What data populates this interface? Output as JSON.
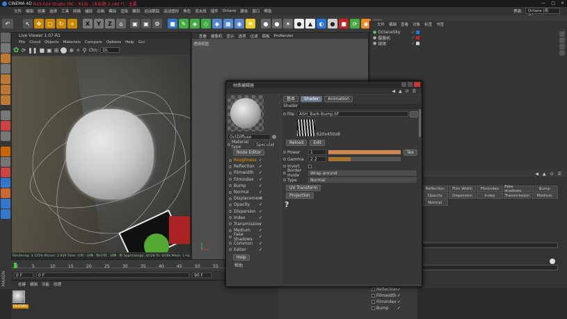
{
  "title_bar": {
    "app_name": "CINEMA 4D",
    "version": "R19.024 Studio (RC - R19) - [未标题 2.c4d *] - 主要",
    "window_controls": [
      "—",
      "□",
      "×"
    ]
  },
  "menu": {
    "items": [
      "文件",
      "编辑",
      "创建",
      "选择",
      "工具",
      "网格",
      "捕捉",
      "动画",
      "模拟",
      "渲染",
      "雕刻",
      "运动跟踪",
      "运动图形",
      "角色",
      "流水线",
      "插件",
      "Octane",
      "脚本",
      "窗口",
      "帮助"
    ],
    "layout_label": "界面:",
    "layout_value": "Octane (用户)"
  },
  "toolbar": {
    "axis_x": "X",
    "axis_y": "Y",
    "axis_z": "Z"
  },
  "live_viewer": {
    "title": "Live Viewer 1.07-R1",
    "menu": [
      "File",
      "Cloud",
      "Objects",
      "Materials",
      "Compare",
      "Options",
      "Help",
      "Gui"
    ],
    "chan_label": "Chn:",
    "chan_value": "DL",
    "status": "Rendering: 3.125% Ms/sec: 2.939  Time: 小时 : 分钟 : 秒/小时 : 分钟 : 秒  Spp/maxspp: 4/128  Tri: 0/16k  Mesh: 1  Hair: 0"
  },
  "viewport": {
    "menu": [
      "查看",
      "摄像机",
      "显示",
      "选项",
      "过滤",
      "面板",
      "ProRender"
    ],
    "label": "透视视图"
  },
  "object_manager": {
    "menu": [
      "文件",
      "编辑",
      "查看",
      "对象",
      "标签",
      "书签"
    ],
    "objects": [
      {
        "name": "OctaneSky"
      },
      {
        "name": "摄像机"
      },
      {
        "name": "球体"
      }
    ]
  },
  "material_editor": {
    "title": "材质编辑器",
    "tabs": {
      "basic": "基本",
      "shader": "Shader",
      "animation": "Animation"
    },
    "material_name": "OctDiffuse",
    "material_type_label": "Material type",
    "material_type_value": "Specular",
    "node_editor": "Node Editor",
    "help_button": "Help",
    "channels": [
      {
        "name": "Roughness",
        "active": true
      },
      {
        "name": "Reflection"
      },
      {
        "name": "Filmwidth"
      },
      {
        "name": "Filmindex"
      },
      {
        "name": "Bump"
      },
      {
        "name": "Normal"
      },
      {
        "name": "Displacement"
      },
      {
        "name": "Opacity"
      },
      {
        "name": "Dispersion"
      },
      {
        "name": "Index"
      },
      {
        "name": "Transmission"
      },
      {
        "name": "Medium"
      },
      {
        "name": "Fake Shadows"
      },
      {
        "name": "Common"
      },
      {
        "name": "Editor"
      }
    ],
    "bottom_label": "帮助",
    "shader": {
      "section": "Shader",
      "file_label": "File",
      "file_value": "ASH_Bark-Bump.tif",
      "resolution": "620x450x8",
      "reload": "Reload",
      "edit": "Edit",
      "power_label": "Power",
      "power_value": "1",
      "power_fill_percent": 100,
      "tex_button": "Tex",
      "gamma_label": "Gamma",
      "gamma_value": "2.2",
      "invert_label": "Invert",
      "border_mode_label": "Border mode",
      "border_mode_value": "Wrap around",
      "type_label": "Type",
      "type_value": "Normal",
      "uv_transform": "UV Transform",
      "projection": "Projection",
      "help_glyph": "?"
    }
  },
  "right_panel": {
    "grid": [
      "Reflection",
      "Film Width",
      "Filmindex",
      "Fake shadows",
      "Bump",
      "Opacity",
      "Dispersion",
      "Index",
      "Transmission",
      "Medium",
      "Normal"
    ]
  },
  "timeline": {
    "ticks": [
      "0",
      "5",
      "10",
      "15",
      "20",
      "25",
      "30",
      "35",
      "40",
      "45",
      "50",
      "55"
    ],
    "current_frame": "0 F",
    "start_frame": "0 F",
    "end_frame": "90 F",
    "frame_marker": "0"
  },
  "material_manager": {
    "menu": [
      "创建",
      "编辑",
      "功能",
      "纹理"
    ],
    "material_label": "OctDiffu"
  },
  "attr_bottom": {
    "rows": [
      "Reflection",
      "Filmwidth",
      "Filmindex",
      "Bump"
    ]
  },
  "maxon": "MAXON"
}
